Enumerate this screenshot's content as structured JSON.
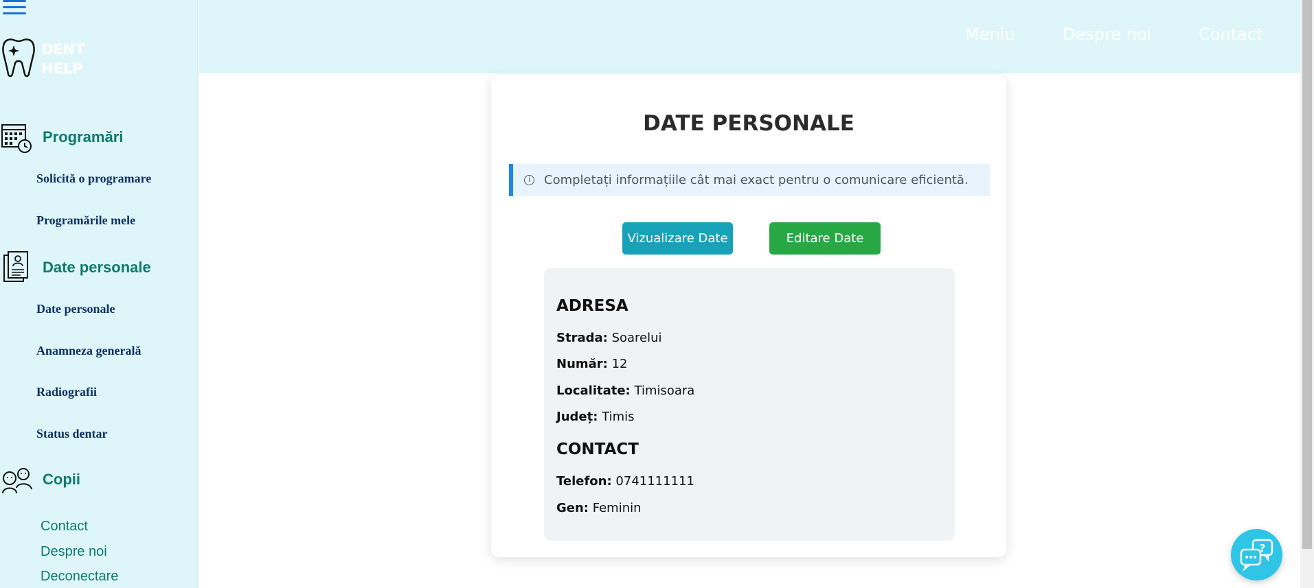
{
  "sidebar": {
    "logo": {
      "line1": "DENT",
      "line2": "HELP"
    },
    "sections": [
      {
        "label": "Programări",
        "icon": "calendar-clock-icon",
        "items": [
          {
            "label": "Solicită o programare"
          },
          {
            "label": "Programările mele"
          }
        ]
      },
      {
        "label": "Date personale",
        "icon": "patient-file-icon",
        "items": [
          {
            "label": "Date personale"
          },
          {
            "label": "Anamneza generală"
          },
          {
            "label": "Radiografii"
          },
          {
            "label": "Status dentar"
          }
        ]
      },
      {
        "label": "Copii",
        "icon": "children-icon",
        "items": []
      }
    ],
    "bottom_links": [
      {
        "label": "Contact"
      },
      {
        "label": "Despre noi"
      },
      {
        "label": "Deconectare"
      }
    ]
  },
  "header": {
    "nav": [
      {
        "label": "Meniu"
      },
      {
        "label": "Despre noi"
      },
      {
        "label": "Contact"
      }
    ]
  },
  "card": {
    "title": "DATE PERSONALE",
    "alert": "Completați informațiile cât mai exact pentru o comunicare eficientă.",
    "buttons": {
      "view": "Vizualizare Date",
      "edit": "Editare Date"
    },
    "address": {
      "heading": "ADRESA",
      "street_label": "Strada:",
      "street": "Soarelui",
      "number_label": "Număr:",
      "number": "12",
      "city_label": "Localitate:",
      "city": "Timisoara",
      "county_label": "Județ:",
      "county": "Timis"
    },
    "contact": {
      "heading": "CONTACT",
      "phone_label": "Telefon:",
      "phone": "0741111111",
      "gender_label": "Gen:",
      "gender": "Feminin"
    }
  },
  "colors": {
    "sidebar_bg": "#def6f9",
    "section_text": "#0e7a6d",
    "sub_item_text": "#0f2f64",
    "view_button": "#17a2b8",
    "edit_button": "#28a745",
    "alert_border": "#1e88e5",
    "chat_button": "#2ec5e6"
  }
}
